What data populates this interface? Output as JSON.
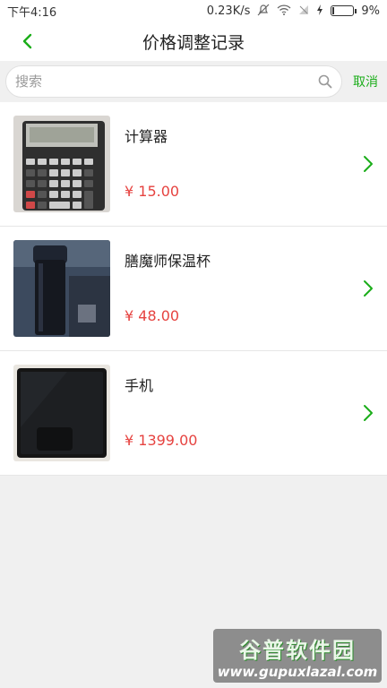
{
  "status": {
    "time": "下午4:16",
    "network_speed": "0.23K/s",
    "battery": "9%"
  },
  "header": {
    "title": "价格调整记录"
  },
  "search": {
    "placeholder": "搜索",
    "value": "",
    "cancel_label": "取消"
  },
  "items": [
    {
      "name": "计算器",
      "price": "¥ 15.00"
    },
    {
      "name": "膳魔师保温杯",
      "price": "¥ 48.00"
    },
    {
      "name": "手机",
      "price": "¥ 1399.00"
    }
  ],
  "watermark": {
    "title": "谷普软件园",
    "url": "www.gupuxlazal.com"
  },
  "colors": {
    "accent": "#1aad19",
    "price": "#e64340",
    "background": "#f0f0f0"
  }
}
